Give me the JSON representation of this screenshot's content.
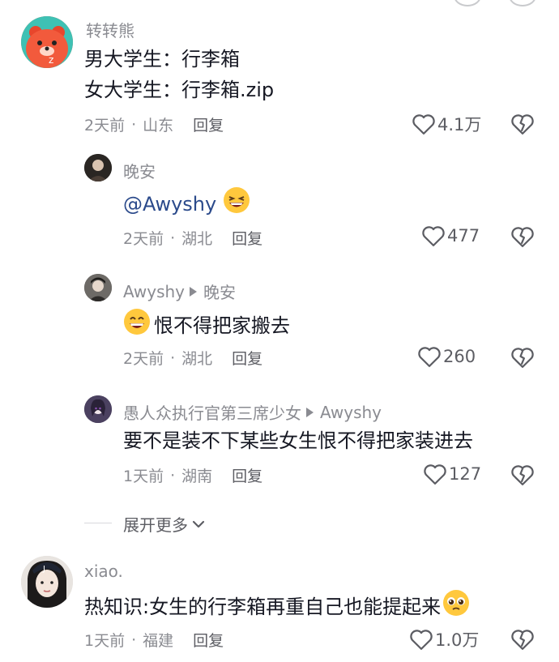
{
  "comments": [
    {
      "username": "转转熊",
      "lines": [
        "男大学生：行李箱",
        "女大学生：行李箱.zip"
      ],
      "time": "2天前",
      "location": "山东",
      "reply_label": "回复",
      "likes": "4.1万"
    },
    {
      "username": "晚安",
      "mention": "@Awyshy",
      "emoji": "laughing-face",
      "time": "2天前",
      "location": "湖北",
      "reply_label": "回复",
      "likes": "477"
    },
    {
      "username": "Awyshy",
      "reply_to": "晚安",
      "emoji": "grinning-face",
      "text": "恨不得把家搬去",
      "time": "2天前",
      "location": "湖北",
      "reply_label": "回复",
      "likes": "260"
    },
    {
      "username": "愚人众执行官第三席少女",
      "reply_to": "Awyshy",
      "text": "要不是装不下某些女生恨不得把家装进去",
      "time": "1天前",
      "location": "湖南",
      "reply_label": "回复",
      "likes": "127"
    },
    {
      "username": "xiao.",
      "text": "热知识:女生的行李箱再重自己也能提起来",
      "emoji": "pleading-face",
      "time": "1天前",
      "location": "福建",
      "reply_label": "回复",
      "likes": "1.0万"
    }
  ],
  "expand_more": "展开更多",
  "colors": {
    "text": "#161823",
    "secondary": "#8a8b91",
    "mention": "#2b4a8b",
    "bear": "#f25a3c"
  }
}
